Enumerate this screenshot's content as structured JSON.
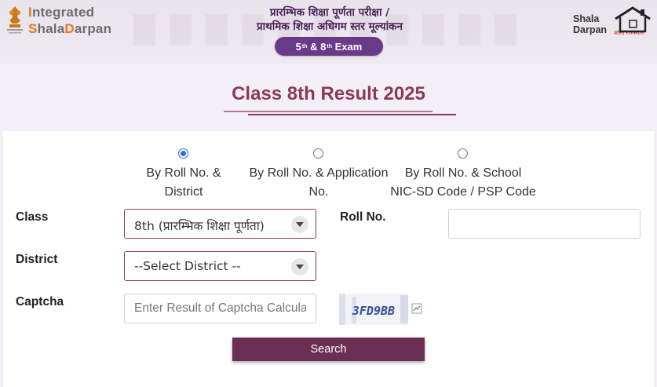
{
  "header": {
    "brand_line1_lead": "I",
    "brand_line1_rest": "ntegrated",
    "brand_line2_lead": "S",
    "brand_line2_mid": "hala",
    "brand_line2_d": "D",
    "brand_line2_rest": "arpan",
    "hindi_line1": "प्रारम्भिक शिक्षा पूर्णता परीक्षा /",
    "hindi_line2": "प्राथमिक शिक्षा अधिगम स्तर मूल्यांकन",
    "exam_badge": {
      "a": "5",
      "a_sup": "th",
      "amp": "&",
      "b": "8",
      "b_sup": "th",
      "word": "Exam"
    },
    "right_logo": {
      "line1": "Shala",
      "line2": "Darpan",
      "tag": "शाला राजस्थान"
    },
    "colors": {
      "accent": "#6a3a8a",
      "orange": "#e07a1f",
      "maroon": "#8b3a55"
    }
  },
  "page": {
    "title": "Class 8th Result 2025"
  },
  "search_modes": [
    {
      "line1": "By Roll No. &",
      "line2": "District",
      "selected": true
    },
    {
      "line1": "By Roll No. & Application",
      "line2": "No.",
      "selected": false
    },
    {
      "line1": "By Roll No. & School",
      "line2": "NIC-SD Code / PSP Code",
      "selected": false
    }
  ],
  "form": {
    "class_label": "Class",
    "class_value": "8th (प्रारम्भिक शिक्षा पूर्णता)",
    "roll_label": "Roll No.",
    "roll_value": "",
    "district_label": "District",
    "district_value": "--Select District --",
    "captcha_label": "Captcha",
    "captcha_placeholder": "Enter Result of Captcha Calculation",
    "captcha_text": "3FD9BB",
    "search_label": "Search"
  },
  "icons": {
    "dropdown": "chevron-down-icon",
    "emblem": "emblem-icon",
    "house": "house-icon",
    "broken_image": "broken-image-icon"
  }
}
